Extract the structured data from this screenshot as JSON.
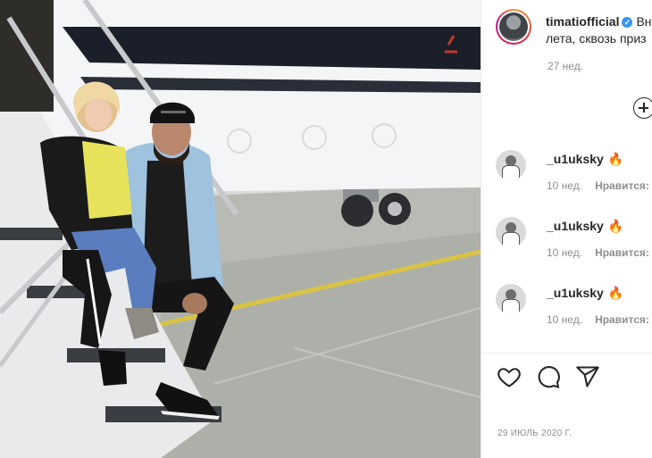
{
  "post": {
    "author": "timatiofficial",
    "verified_mark": "✓",
    "caption_start": "Вн",
    "caption_line2": "лета, сквозь приз",
    "time_ago": "27 нед.",
    "date": "29 ИЮЛЬ 2020 Г."
  },
  "comments": [
    {
      "user": "_u1uksky",
      "emoji": "🔥",
      "time": "10 нед.",
      "like_label": "Нравится:"
    },
    {
      "user": "_u1uksky",
      "emoji": "🔥",
      "time": "10 нед.",
      "like_label": "Нравится:"
    },
    {
      "user": "_u1uksky",
      "emoji": "🔥",
      "time": "10 нед.",
      "like_label": "Нравится:"
    }
  ],
  "icons": {
    "more": "plus-circle-icon",
    "like": "heart-icon",
    "comment": "comment-icon",
    "share": "send-icon"
  },
  "colors": {
    "verified": "#3897f0",
    "secondary_text": "#8e8e8e",
    "primary_text": "#262626"
  }
}
